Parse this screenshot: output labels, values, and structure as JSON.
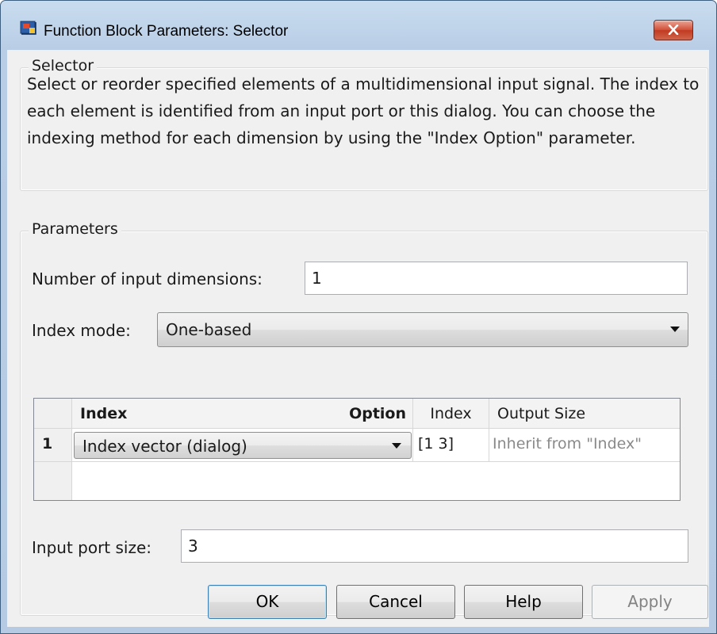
{
  "window": {
    "title": "Function Block Parameters: Selector"
  },
  "description_group": {
    "legend": "Selector",
    "text": "Select or reorder specified elements of a multidimensional input signal. The index to each element is identified from an input port or this dialog. You can choose the indexing method for each dimension by using the \"Index Option\" parameter."
  },
  "parameters_group": {
    "legend": "Parameters",
    "num_dims_label": "Number of input dimensions:",
    "num_dims_value": "1",
    "index_mode_label": "Index mode:",
    "index_mode_value": "One-based",
    "table": {
      "headers": [
        "Index",
        "Option",
        "Index",
        "Output Size"
      ],
      "rows": [
        {
          "row_num": "1",
          "option": "Index vector (dialog)",
          "index": "[1 3]",
          "output_size": "Inherit from \"Index\""
        }
      ]
    },
    "port_size_label": "Input port size:",
    "port_size_value": "3"
  },
  "buttons": {
    "ok": "OK",
    "cancel": "Cancel",
    "help": "Help",
    "apply": "Apply"
  },
  "icons": {
    "app": "simulink-block-icon",
    "close": "close-icon"
  },
  "colors": {
    "titlebar": "#b9cee6",
    "close_button": "#c8442c",
    "default_button_border": "#3c7fb1"
  }
}
